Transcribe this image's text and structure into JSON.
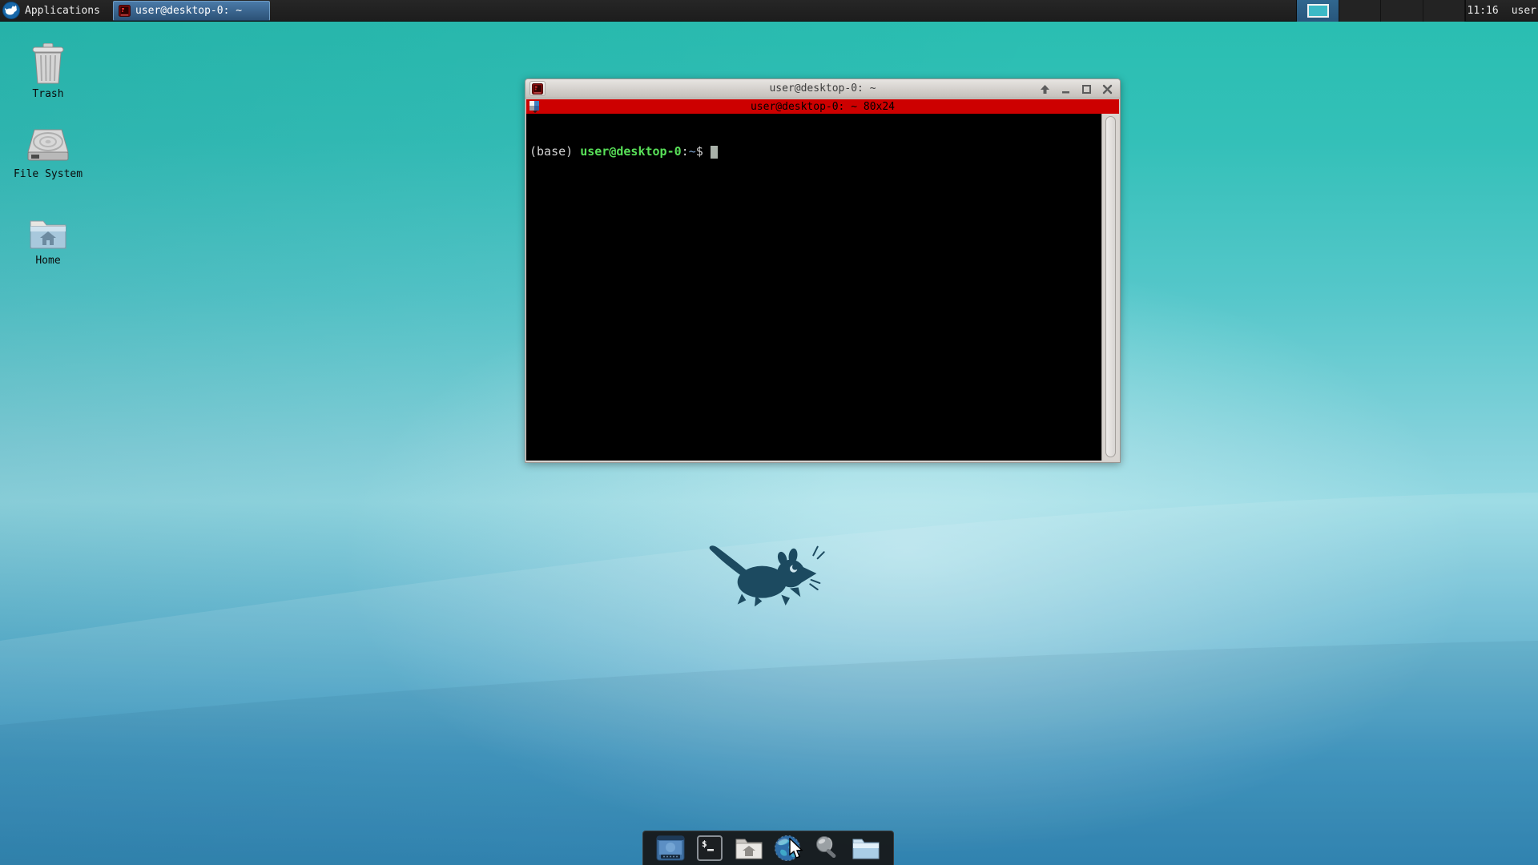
{
  "colors": {
    "desktop_teal_top": "#28beb0",
    "desktop_blue_bottom": "#1e7cae",
    "panel_bg": "#1d1d1d",
    "active_task_blue": "#3a6d9c",
    "xterm_titlebar_red": "#cd0000",
    "prompt_green": "#58e058",
    "prompt_path_blue": "#7da2ce",
    "terminal_bg": "#000000",
    "window_frame_gray": "#d6d2ce"
  },
  "panel": {
    "applications_label": "Applications",
    "taskbar_button_label": "user@desktop-0: ~",
    "clock": "11:16",
    "username": "user",
    "workspace_count": 4,
    "active_workspace": 1
  },
  "desktop_icons": [
    {
      "label": "Trash"
    },
    {
      "label": "File System"
    },
    {
      "label": "Home"
    }
  ],
  "terminal_window": {
    "title": "user@desktop-0: ~",
    "tab_title": "user@desktop-0: ~ 80x24",
    "size": "80x24",
    "prompt": {
      "env": "(base) ",
      "user_host": "user@desktop-0",
      "separator": ":",
      "path": "~",
      "symbol": "$"
    }
  },
  "dock_items": [
    {
      "name": "show-desktop"
    },
    {
      "name": "terminal"
    },
    {
      "name": "home-folder"
    },
    {
      "name": "web-browser"
    },
    {
      "name": "file-search"
    },
    {
      "name": "file-manager"
    }
  ]
}
